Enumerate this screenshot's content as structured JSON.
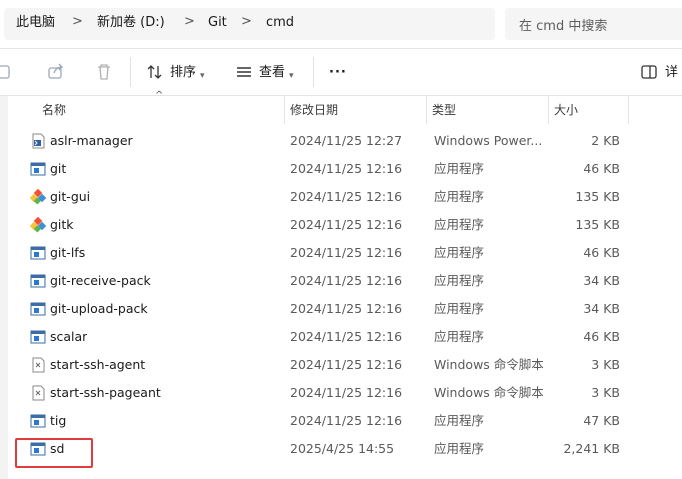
{
  "breadcrumb": {
    "items": [
      "此电脑",
      "新加卷 (D:)",
      "Git",
      "cmd"
    ],
    "separator": ">"
  },
  "search": {
    "placeholder": "在 cmd 中搜索"
  },
  "toolbar": {
    "sort_label": "排序",
    "view_label": "查看",
    "more_label": "···",
    "details_label": "详"
  },
  "columns": {
    "name": "名称",
    "date": "修改日期",
    "type": "类型",
    "size": "大小"
  },
  "files": [
    {
      "name": "aslr-manager",
      "date": "2024/11/25 12:27",
      "type": "Windows Power...",
      "size": "2 KB",
      "icon": "powershell-icon"
    },
    {
      "name": "git",
      "date": "2024/11/25 12:16",
      "type": "应用程序",
      "size": "46 KB",
      "icon": "app-icon"
    },
    {
      "name": "git-gui",
      "date": "2024/11/25 12:16",
      "type": "应用程序",
      "size": "135 KB",
      "icon": "git-diamond-icon"
    },
    {
      "name": "gitk",
      "date": "2024/11/25 12:16",
      "type": "应用程序",
      "size": "135 KB",
      "icon": "git-diamond-icon"
    },
    {
      "name": "git-lfs",
      "date": "2024/11/25 12:16",
      "type": "应用程序",
      "size": "46 KB",
      "icon": "app-icon"
    },
    {
      "name": "git-receive-pack",
      "date": "2024/11/25 12:16",
      "type": "应用程序",
      "size": "34 KB",
      "icon": "app-icon"
    },
    {
      "name": "git-upload-pack",
      "date": "2024/11/25 12:16",
      "type": "应用程序",
      "size": "34 KB",
      "icon": "app-icon"
    },
    {
      "name": "scalar",
      "date": "2024/11/25 12:16",
      "type": "应用程序",
      "size": "46 KB",
      "icon": "app-icon"
    },
    {
      "name": "start-ssh-agent",
      "date": "2024/11/25 12:16",
      "type": "Windows 命令脚本",
      "size": "3 KB",
      "icon": "script-icon"
    },
    {
      "name": "start-ssh-pageant",
      "date": "2024/11/25 12:16",
      "type": "Windows 命令脚本",
      "size": "3 KB",
      "icon": "script-icon"
    },
    {
      "name": "tig",
      "date": "2024/11/25 12:16",
      "type": "应用程序",
      "size": "47 KB",
      "icon": "app-icon"
    },
    {
      "name": "sd",
      "date": "2025/4/25 14:55",
      "type": "应用程序",
      "size": "2,241 KB",
      "icon": "app-icon"
    }
  ],
  "colors": {
    "highlight": "#e23b3b",
    "accent": "#1e6fd0"
  }
}
